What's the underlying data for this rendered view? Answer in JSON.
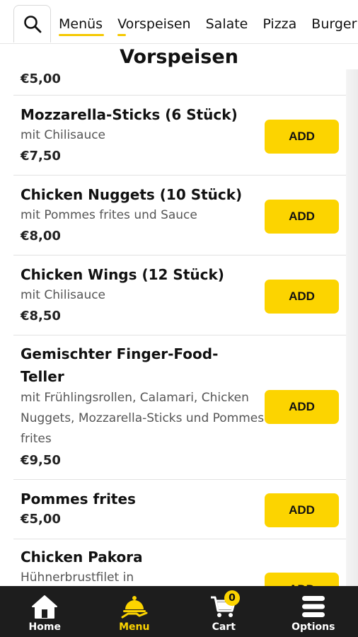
{
  "header": {
    "tabs": [
      {
        "label": "Menüs",
        "active": true
      },
      {
        "label": "Vorspeisen",
        "active": true
      },
      {
        "label": "Salate",
        "active": false
      },
      {
        "label": "Pizza",
        "active": false
      },
      {
        "label": "Burger",
        "active": false
      }
    ],
    "search_icon": "search-icon"
  },
  "section": {
    "title": "Vorspeisen"
  },
  "items": [
    {
      "price": "€5,00"
    },
    {
      "name": "Mozzarella-Sticks (6 Stück)",
      "desc": "mit Chilisauce",
      "price": "€7,50",
      "button": "ADD"
    },
    {
      "name": "Chicken Nuggets (10 Stück)",
      "desc": "mit Pommes frites und Sauce",
      "price": "€8,00",
      "button": "ADD"
    },
    {
      "name": "Chicken Wings (12 Stück)",
      "desc": "mit Chilisauce",
      "price": "€8,50",
      "button": "ADD"
    },
    {
      "name": "Gemischter Finger-Food-Teller",
      "desc": "mit Frühlingsrollen, Calamari, Chicken Nuggets, Mozzarella-Sticks und Pommes frites",
      "price": "€9,50",
      "button": "ADD"
    },
    {
      "name": "Pommes frites",
      "price": "€5,00",
      "button": "ADD"
    },
    {
      "name": "Chicken Pakora",
      "desc": "Hühnerbrustfilet in",
      "button": "ADD"
    }
  ],
  "bottom_nav": {
    "items": [
      {
        "label": "Home",
        "icon": "home-icon",
        "active": false
      },
      {
        "label": "Menu",
        "icon": "menu-cloche-icon",
        "active": true
      },
      {
        "label": "Cart",
        "icon": "cart-icon",
        "active": false,
        "badge": "0"
      },
      {
        "label": "Options",
        "icon": "hamburger-icon",
        "active": false
      }
    ]
  },
  "colors": {
    "accent": "#fcd400",
    "nav_bg": "#1d1d1d",
    "text": "#111111"
  }
}
